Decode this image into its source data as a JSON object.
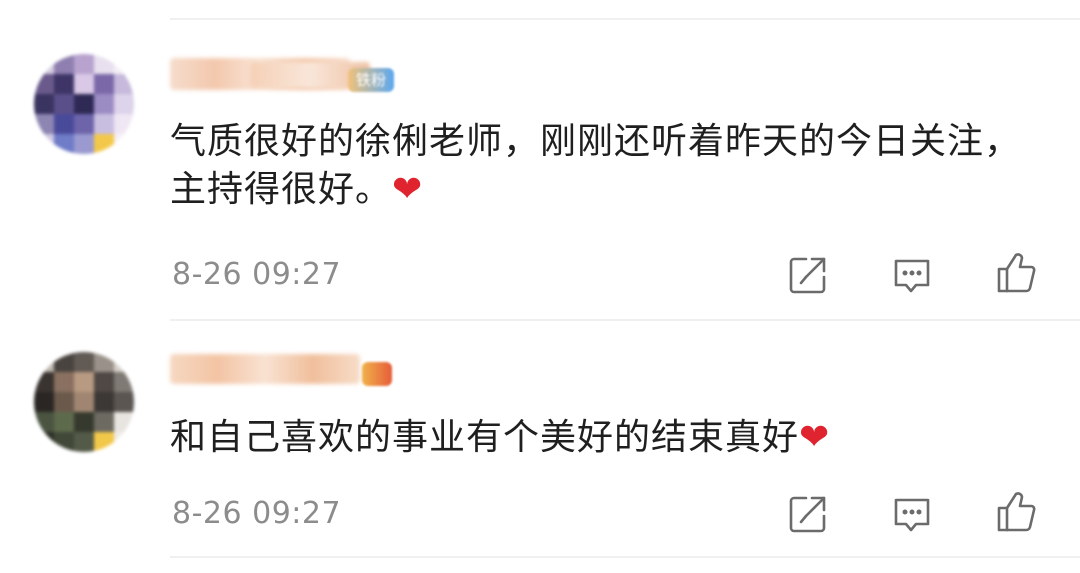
{
  "comments": [
    {
      "text": "气质很好的徐俐老师，刚刚还听着昨天的今日关注，主持得很好。",
      "heart": "❤",
      "time": "8-26 09:27",
      "badge": "铁粉"
    },
    {
      "text": "和自己喜欢的事业有个美好的结束真好",
      "heart": "❤",
      "time": "8-26 09:27"
    }
  ],
  "icons": {
    "share": "share-icon",
    "reply": "comment-icon",
    "like": "thumbs-up-icon"
  },
  "colors": {
    "text": "#1f1f1f",
    "meta": "#8c8c8c",
    "heart": "#e0242f",
    "badge": "#5ba8f0",
    "divider": "#f0f0f0"
  }
}
